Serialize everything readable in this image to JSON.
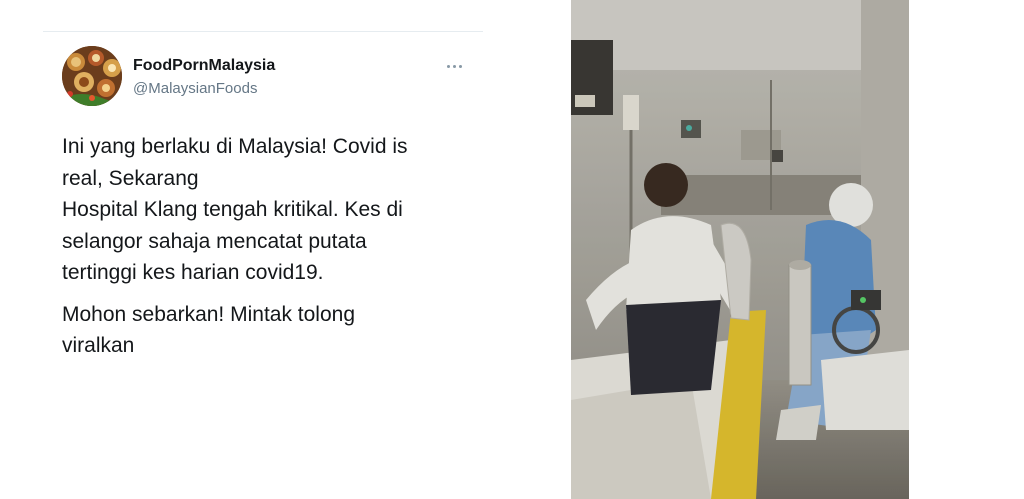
{
  "tweet": {
    "author": {
      "display_name": "FoodPornMalaysia",
      "handle": "@MalaysianFoods",
      "avatar_icon": "food-avatar-icon"
    },
    "more_icon": "more-horizontal-icon",
    "text_lines": [
      "Ini yang berlaku di Malaysia! Covid is",
      "real, Sekarang",
      "Hospital Klang tengah kritikal. Kes di",
      "selangor sahaja mencatat putata",
      "tertinggi kes harian covid19."
    ],
    "text_second_paragraph_lines": [
      "Mohon sebarkan! Mintak tolong",
      "viralkan"
    ],
    "media": {
      "type": "video-still",
      "colors": {
        "wall": "#b5b3ac",
        "ppe": "#5f90c4",
        "curtain": "#e0c02e"
      }
    }
  }
}
